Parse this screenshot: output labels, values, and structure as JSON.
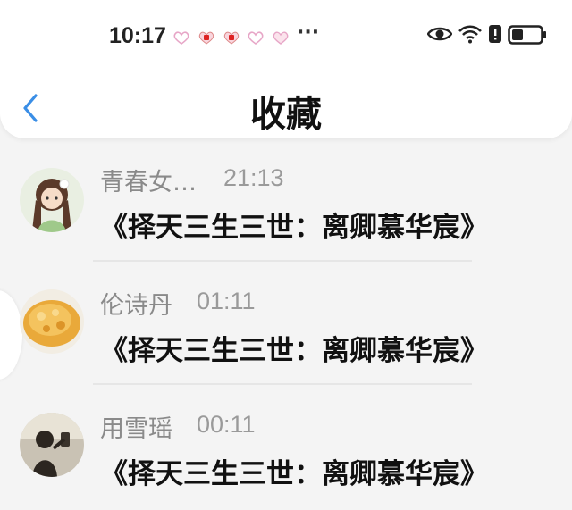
{
  "status_bar": {
    "time": "10:17",
    "overflow": "···",
    "icons": [
      "heart-notification-icon",
      "red-notification-icon",
      "red-notification-icon",
      "heart-notification-icon",
      "heart-notification-icon",
      "eye-icon",
      "wifi-icon",
      "battery-saver-icon",
      "battery-icon"
    ]
  },
  "nav": {
    "back_icon": "chevron-left-icon",
    "title": "收藏",
    "accent": "#3a8ee6"
  },
  "items": [
    {
      "name": "青春女…",
      "time": "21:13",
      "message": "《择天三生三世：离卿慕华宸》"
    },
    {
      "name": "伦诗丹",
      "time": "01:11",
      "message": "《择天三生三世：离卿慕华宸》"
    },
    {
      "name": "用雪瑶",
      "time": "00:11",
      "message": "《择天三生三世：离卿慕华宸》"
    }
  ]
}
